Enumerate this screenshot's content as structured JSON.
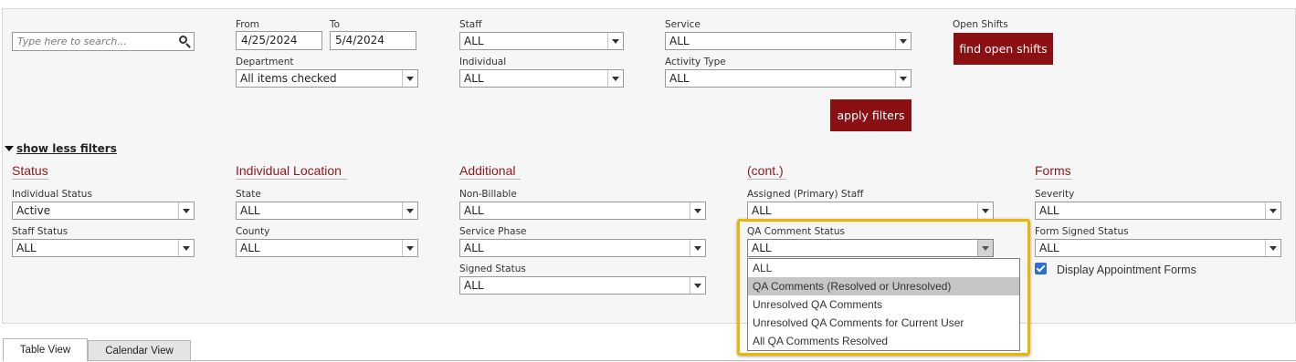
{
  "search": {
    "placeholder": "Type here to search..."
  },
  "filters": {
    "from_label": "From",
    "from_value": "4/25/2024",
    "to_label": "To",
    "to_value": "5/4/2024",
    "department_label": "Department",
    "department_value": "All items checked",
    "staff_label": "Staff",
    "staff_value": "ALL",
    "individual_label": "Individual",
    "individual_value": "ALL",
    "service_label": "Service",
    "service_value": "ALL",
    "activity_type_label": "Activity Type",
    "activity_type_value": "ALL",
    "open_shifts_label": "Open Shifts",
    "find_open_shifts_label": "find open shifts",
    "apply_filters_label": "apply filters",
    "show_less_label": "show less filters"
  },
  "sections": {
    "status": {
      "title": "Status",
      "individual_status_label": "Individual Status",
      "individual_status_value": "Active",
      "staff_status_label": "Staff Status",
      "staff_status_value": "ALL"
    },
    "location": {
      "title": "Individual Location",
      "state_label": "State",
      "state_value": "ALL",
      "county_label": "County",
      "county_value": "ALL"
    },
    "additional": {
      "title": "Additional",
      "non_billable_label": "Non-Billable",
      "non_billable_value": "ALL",
      "service_phase_label": "Service Phase",
      "service_phase_value": "ALL",
      "signed_status_label": "Signed Status",
      "signed_status_value": "ALL"
    },
    "cont": {
      "title": "(cont.)",
      "assigned_staff_label": "Assigned (Primary) Staff",
      "assigned_staff_value": "ALL",
      "qa_comment_label": "QA Comment Status",
      "qa_comment_value": "ALL",
      "qa_options": [
        "ALL",
        "QA Comments (Resolved or Unresolved)",
        "Unresolved QA Comments",
        "Unresolved QA Comments for Current User",
        "All QA Comments Resolved"
      ],
      "qa_highlighted_option": "QA Comments (Resolved or Unresolved)"
    },
    "forms": {
      "title": "Forms",
      "severity_label": "Severity",
      "severity_value": "ALL",
      "form_signed_label": "Form Signed Status",
      "form_signed_value": "ALL",
      "display_appointment_label": "Display Appointment Forms",
      "display_appointment_checked": true
    }
  },
  "tabs": {
    "table_view": "Table View",
    "calendar_view": "Calendar View"
  },
  "colors": {
    "accent": "#8b1014",
    "highlight_border": "#f0b400",
    "checkbox": "#2a6fd1"
  },
  "icons": [
    "search-icon",
    "chevron-down-icon",
    "triangle-down-icon",
    "checkbox-checked-icon"
  ]
}
